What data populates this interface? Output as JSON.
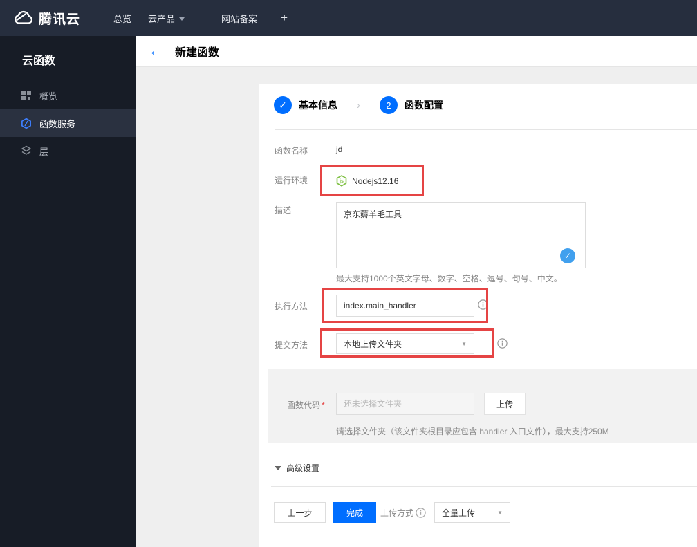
{
  "colors": {
    "accent_blue": "#006eff",
    "annotation_red": "#e54444",
    "check_blue": "#41a0ee",
    "node_green": "#7fc043",
    "topbar_bg": "#262e3e",
    "sidebar_bg": "#171c26",
    "sidebar_active_bg": "#2a3140"
  },
  "topbar": {
    "brand": "腾讯云",
    "logo_icon": "tencent-cloud-logo",
    "items": [
      {
        "label": "总览"
      },
      {
        "label": "云产品"
      },
      {
        "label": "网站备案"
      },
      {
        "label": "+"
      }
    ]
  },
  "sidebar": {
    "title": "云函数",
    "items": [
      {
        "label": "概览",
        "icon": "grid-icon",
        "active": false
      },
      {
        "label": "函数服务",
        "icon": "function-hexagon-icon",
        "active": true
      },
      {
        "label": "层",
        "icon": "layers-icon",
        "active": false
      }
    ]
  },
  "page_header": {
    "back_icon": "back-arrow-icon",
    "title": "新建函数"
  },
  "steps": {
    "step1": {
      "label": "基本信息",
      "state": "done",
      "icon": "check-icon"
    },
    "separator": "›",
    "step2": {
      "num": "2",
      "label": "函数配置",
      "state": "current"
    }
  },
  "form": {
    "name": {
      "label": "函数名称",
      "value": "jd"
    },
    "runtime": {
      "label": "运行环境",
      "value": "Nodejs12.16",
      "icon": "nodejs-icon"
    },
    "description": {
      "label": "描述",
      "value": "京东薅羊毛工具",
      "helper": "最大支持1000个英文字母、数字、空格、逗号、句号、中文。"
    },
    "handler": {
      "label": "执行方法",
      "value": "index.main_handler"
    },
    "submit_method": {
      "label": "提交方法",
      "value": "本地上传文件夹"
    },
    "code": {
      "label": "函数代码",
      "required_mark": "*",
      "placeholder": "还未选择文件夹",
      "upload_button": "上传",
      "helper": "请选择文件夹（该文件夹根目录应包含 handler 入口文件），最大支持250M"
    },
    "advanced_toggle": "高级设置"
  },
  "footer": {
    "prev_button": "上一步",
    "finish_button": "完成",
    "upload_mode_label": "上传方式",
    "upload_mode_value": "全量上传"
  }
}
